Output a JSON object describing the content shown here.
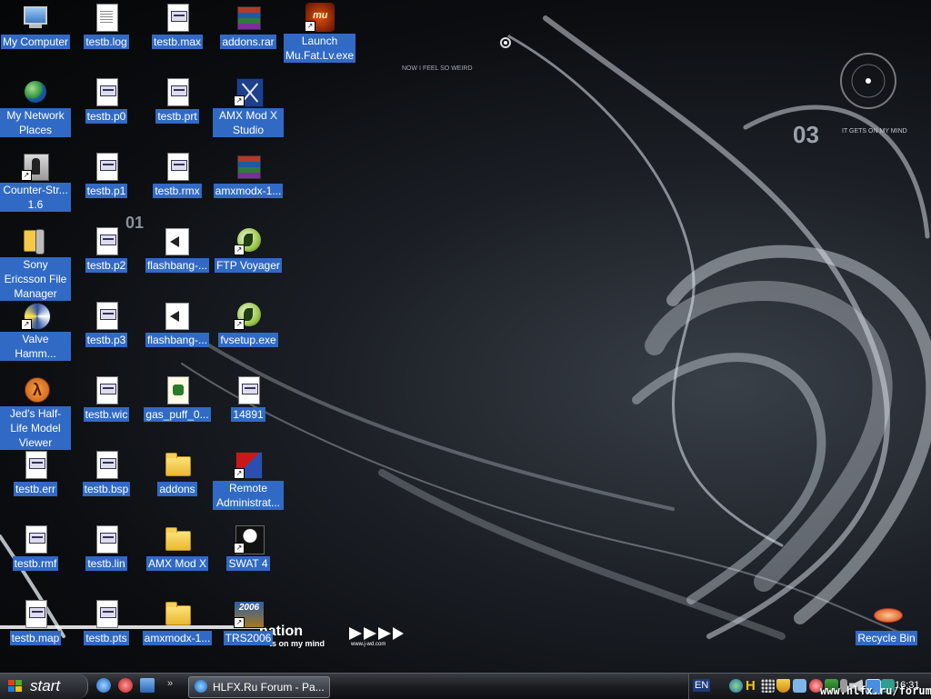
{
  "desktop": {
    "icons": [
      {
        "label": "My Computer",
        "icon": "my-computer-icon"
      },
      {
        "label": "My Network Places",
        "icon": "network-places-icon"
      },
      {
        "label": "Counter-Str... 1.6",
        "icon": "counter-strike-icon"
      },
      {
        "label": "Sony Ericsson File Manager",
        "icon": "phone-icon"
      },
      {
        "label": "Valve Hamm...",
        "icon": "valve-hammer-icon"
      },
      {
        "label": "Jed's Half-Life Model Viewer",
        "icon": "half-life-icon"
      },
      {
        "label": "testb.err",
        "icon": "file-icon"
      },
      {
        "label": "testb.rmf",
        "icon": "globe-file-icon"
      },
      {
        "label": "testb.map",
        "icon": "file-icon"
      },
      {
        "label": "testb.log",
        "icon": "text-file-icon"
      },
      {
        "label": "testb.p0",
        "icon": "file-icon"
      },
      {
        "label": "testb.p1",
        "icon": "file-icon"
      },
      {
        "label": "testb.p2",
        "icon": "file-icon"
      },
      {
        "label": "testb.p3",
        "icon": "file-icon"
      },
      {
        "label": "testb.wic",
        "icon": "file-icon"
      },
      {
        "label": "testb.bsp",
        "icon": "file-icon"
      },
      {
        "label": "testb.lin",
        "icon": "file-icon"
      },
      {
        "label": "testb.pts",
        "icon": "file-icon"
      },
      {
        "label": "testb.max",
        "icon": "file-icon"
      },
      {
        "label": "testb.prt",
        "icon": "file-icon"
      },
      {
        "label": "testb.rmx",
        "icon": "file-icon"
      },
      {
        "label": "flashbang-...",
        "icon": "sound-file-icon"
      },
      {
        "label": "flashbang-...",
        "icon": "sound-file-icon"
      },
      {
        "label": "gas_puff_0...",
        "icon": "script-file-icon"
      },
      {
        "label": "addons",
        "icon": "folder-icon"
      },
      {
        "label": "AMX Mod X",
        "icon": "folder-icon"
      },
      {
        "label": "amxmodx-1...",
        "icon": "folder-icon"
      },
      {
        "label": "addons.rar",
        "icon": "winrar-icon"
      },
      {
        "label": "AMX Mod X Studio",
        "icon": "amx-studio-icon"
      },
      {
        "label": "amxmodx-1...",
        "icon": "winrar-icon"
      },
      {
        "label": "FTP Voyager",
        "icon": "ftp-voyager-icon"
      },
      {
        "label": "fvsetup.exe",
        "icon": "ftp-voyager-icon"
      },
      {
        "label": "14891",
        "icon": "file-icon"
      },
      {
        "label": "Remote Administrat...",
        "icon": "remote-admin-icon"
      },
      {
        "label": "SWAT 4",
        "icon": "swat-icon"
      },
      {
        "label": "TRS2006",
        "icon": "trs2006-icon"
      },
      {
        "label": "Launch Mu.Fat.Lv.exe",
        "icon": "mu-online-icon"
      },
      {
        "label": "Recycle Bin",
        "icon": "recycle-bin-icon"
      }
    ]
  },
  "wallpaper": {
    "texts": [
      "IT GETS ON MY MIND",
      "03",
      "01",
      "NOW I FEEL SO WEIRD",
      "ts on my mind",
      "www.j-wd.com",
      "nation"
    ]
  },
  "taskbar": {
    "start_label": "start",
    "task_label": "HLFX.Ru Forum - Pa...",
    "language": "EN",
    "clock": "16:31",
    "watermark": "www.hlfx.ru/forum"
  },
  "colors": {
    "selection": "#316ac5",
    "taskbar": "#1b1d21"
  }
}
